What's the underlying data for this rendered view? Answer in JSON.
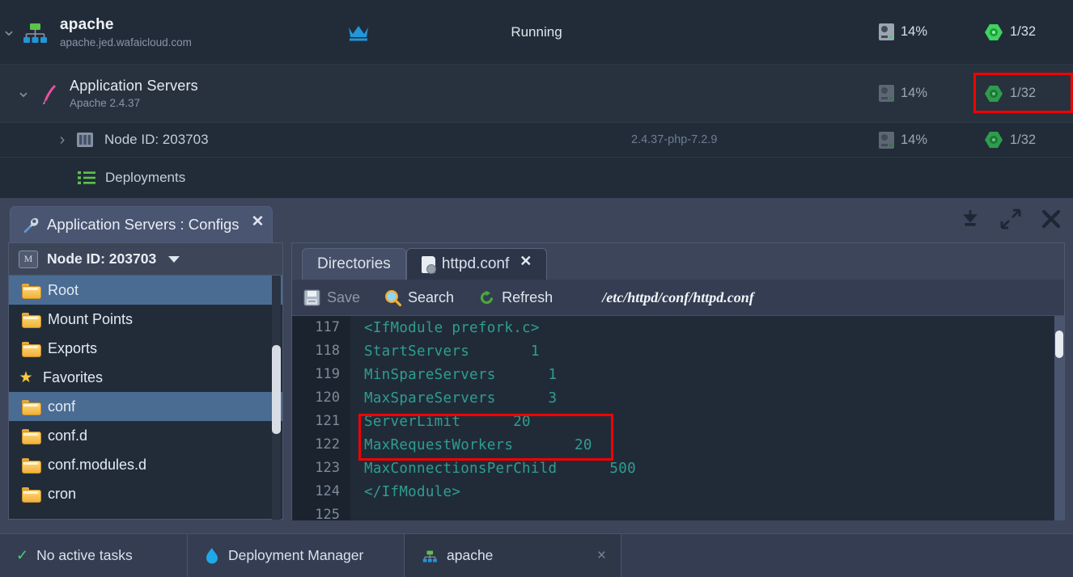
{
  "env": {
    "name": "apache",
    "domain": "apache.jed.wafaicloud.com",
    "status": "Running",
    "icon": "environment-topology-icon",
    "crown_icon": "crown-icon",
    "cpu": "14%",
    "ram": "1/32"
  },
  "tree": {
    "layer": {
      "title": "Application Servers",
      "subtitle": "Apache 2.4.37",
      "icon": "apache-feather-icon",
      "cpu": "14%",
      "ram": "1/32"
    },
    "node": {
      "title": "Node ID: 203703",
      "version": "2.4.37-php-7.2.9",
      "icon": "node-stack-icon",
      "cpu": "14%",
      "ram": "1/32"
    },
    "deployments": {
      "title": "Deployments",
      "icon": "deployments-list-icon"
    }
  },
  "config_window": {
    "tab_title": "Application Servers : Configs",
    "tab_icon": "wrench-icon",
    "tab_close": "✕",
    "controls": {
      "download": "download-icon",
      "expand": "expand-icon",
      "close": "close-icon"
    },
    "sidebar": {
      "header_badge": "M",
      "header_label": "Node ID: 203703",
      "items": [
        {
          "label": "Root",
          "icon": "folder-icon",
          "selected": true
        },
        {
          "label": "Mount Points",
          "icon": "folder-mount-icon",
          "selected": false
        },
        {
          "label": "Exports",
          "icon": "folder-export-icon",
          "selected": false
        },
        {
          "label": "Favorites",
          "icon": "star-icon",
          "selected": false
        },
        {
          "label": "conf",
          "icon": "folder-icon",
          "selected": true
        },
        {
          "label": "conf.d",
          "icon": "folder-icon",
          "selected": false
        },
        {
          "label": "conf.modules.d",
          "icon": "folder-icon",
          "selected": false
        },
        {
          "label": "cron",
          "icon": "folder-icon",
          "selected": false
        }
      ]
    },
    "editor": {
      "tabs": [
        {
          "label": "Directories",
          "active": false,
          "closable": false
        },
        {
          "label": "httpd.conf",
          "active": true,
          "closable": true,
          "icon": "file-config-icon"
        }
      ],
      "toolbar": {
        "save": "Save",
        "save_icon": "floppy-disk-icon",
        "search": "Search",
        "search_icon": "magnifier-icon",
        "refresh": "Refresh",
        "refresh_icon": "refresh-arrow-icon"
      },
      "path": "/etc/httpd/conf/httpd.conf",
      "lines": [
        {
          "num": "117",
          "text": "<IfModule prefork.c>"
        },
        {
          "num": "118",
          "text": "StartServers       1"
        },
        {
          "num": "119",
          "text": "MinSpareServers      1"
        },
        {
          "num": "120",
          "text": "MaxSpareServers      3"
        },
        {
          "num": "121",
          "text": "ServerLimit      20"
        },
        {
          "num": "122",
          "text": "MaxRequestWorkers       20"
        },
        {
          "num": "123",
          "text": "MaxConnectionsPerChild      500"
        },
        {
          "num": "124",
          "text": "</IfModule>"
        },
        {
          "num": "125",
          "text": ""
        }
      ]
    }
  },
  "bottom_bar": {
    "tasks": "No active tasks",
    "tasks_icon": "checkmark-icon",
    "deployment_manager": "Deployment Manager",
    "deployment_manager_icon": "flame-icon",
    "app_tab": "apache",
    "app_tab_icon": "environment-topology-icon",
    "app_tab_close": "×"
  },
  "colors": {
    "accent_blue": "#2196d8",
    "green": "#49d06a",
    "highlight_red": "#f40000",
    "folder_yellow": "#f0b23c",
    "code_teal": "#2e9e8f",
    "selection_blue": "#4a6c93"
  }
}
